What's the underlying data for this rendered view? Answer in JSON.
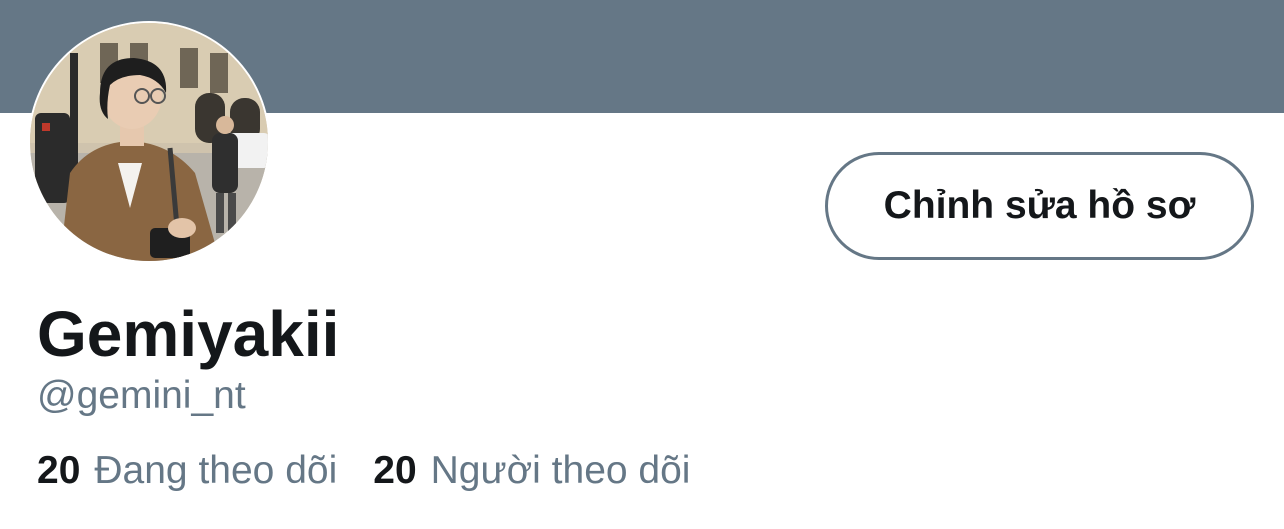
{
  "colors": {
    "banner": "#657786",
    "text_primary": "#14171a",
    "text_secondary": "#657786"
  },
  "profile": {
    "display_name": "Gemiyakii",
    "handle": "@gemini_nt",
    "avatar_icon": "profile-photo"
  },
  "actions": {
    "edit_profile_label": "Chỉnh sửa hồ sơ"
  },
  "stats": {
    "following_count": "20",
    "following_label": "Đang theo dõi",
    "followers_count": "20",
    "followers_label": "Người theo dõi"
  }
}
